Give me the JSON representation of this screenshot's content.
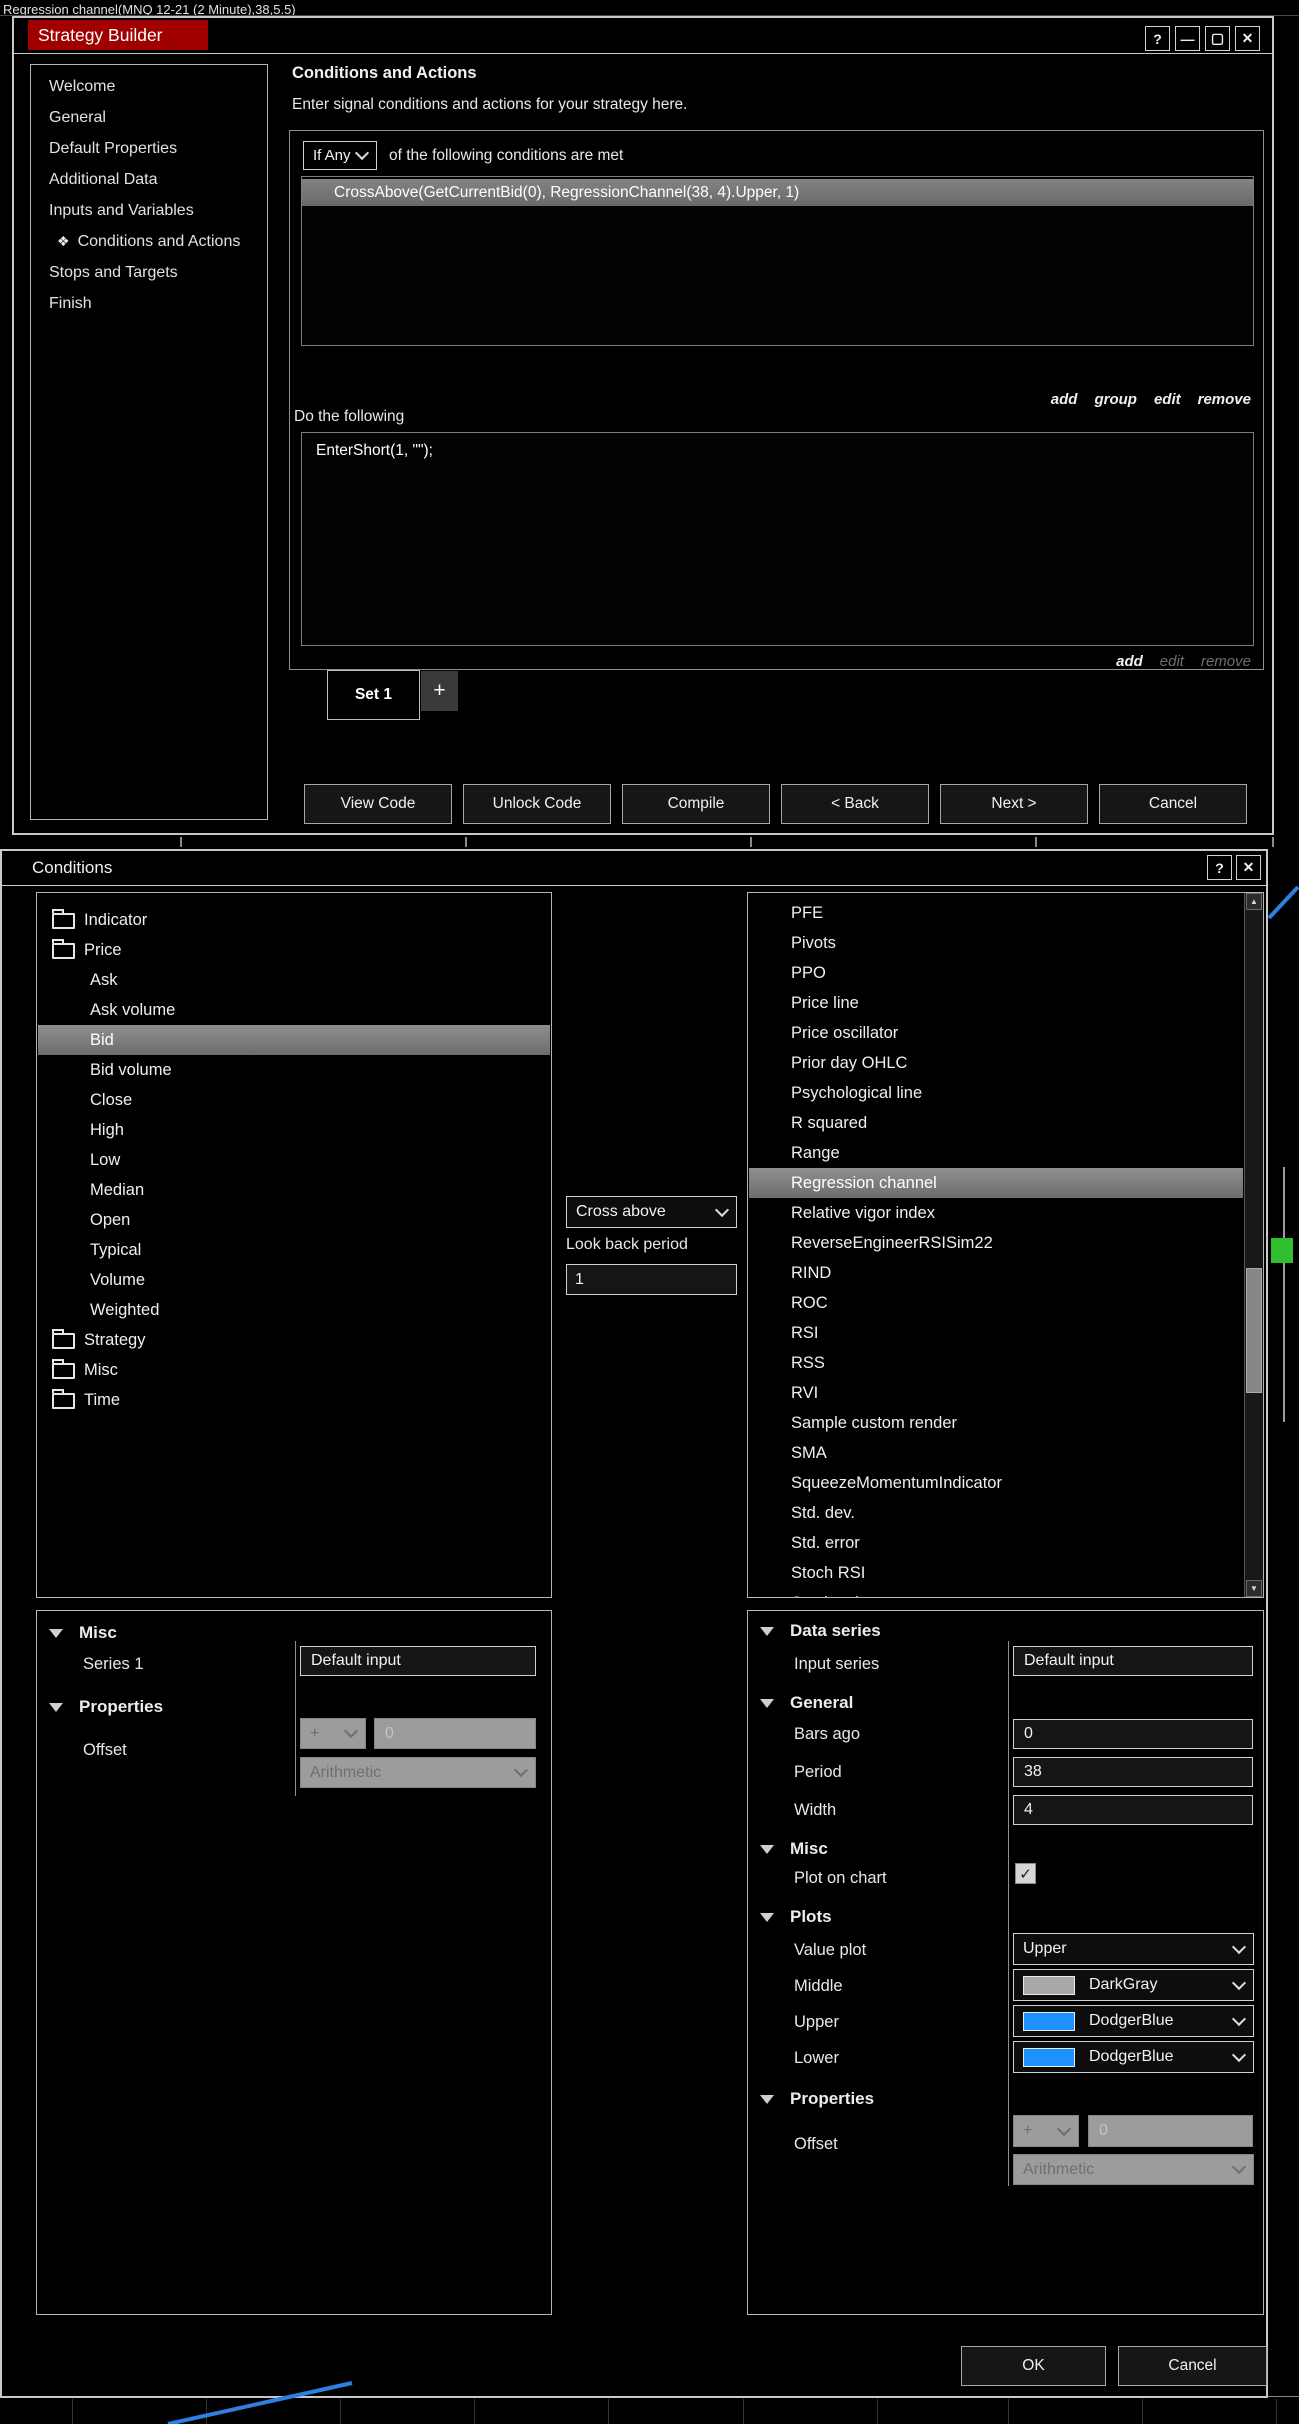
{
  "background": {
    "chart_label": "Regression channel(MNQ 12-21 (2 Minute),38,5.5)"
  },
  "colors": {
    "titlebar_red": "#A00000",
    "selection_gray": "#7a7a7a",
    "dodger_blue": "#1E90FF",
    "dark_gray_swatch": "#A9A9A9",
    "green_marker": "#2FBF2F",
    "channel_line_blue": "#2F7FE0"
  },
  "strategy_builder": {
    "title": "Strategy Builder",
    "window_controls": [
      {
        "name": "help",
        "glyph": "?"
      },
      {
        "name": "minimize",
        "glyph": "—"
      },
      {
        "name": "maximize",
        "glyph": "▢"
      },
      {
        "name": "close",
        "glyph": "✕"
      }
    ],
    "sidebar": [
      {
        "label": "Welcome"
      },
      {
        "label": "General"
      },
      {
        "label": "Default Properties"
      },
      {
        "label": "Additional Data"
      },
      {
        "label": "Inputs and Variables"
      },
      {
        "label": "Conditions and Actions",
        "selected": true,
        "icon": "❖"
      },
      {
        "label": "Stops and Targets"
      },
      {
        "label": "Finish"
      }
    ],
    "heading": "Conditions and Actions",
    "subheading": "Enter signal conditions and actions for your strategy here.",
    "condition_mode": "If Any",
    "mode_suffix": "of the following conditions are met",
    "conditions": [
      "CrossAbove(GetCurrentBid(0), RegressionChannel(38, 4).Upper, 1)"
    ],
    "conditions_links": [
      {
        "label": "add",
        "enabled": true
      },
      {
        "label": "group",
        "enabled": true
      },
      {
        "label": "edit",
        "enabled": true
      },
      {
        "label": "remove",
        "enabled": true
      }
    ],
    "do_following_label": "Do the following",
    "actions": [
      "EnterShort(1, \"\");"
    ],
    "actions_links": [
      {
        "label": "add",
        "enabled": true
      },
      {
        "label": "edit",
        "enabled": false
      },
      {
        "label": "remove",
        "enabled": false
      }
    ],
    "set_tab_label": "Set 1",
    "add_tab_label": "+",
    "footer_buttons": [
      "View Code",
      "Unlock Code",
      "Compile",
      "< Back",
      "Next >",
      "Cancel"
    ]
  },
  "conditions_dialog": {
    "title": "Conditions",
    "window_controls": [
      {
        "name": "help",
        "glyph": "?"
      },
      {
        "name": "close",
        "glyph": "✕"
      }
    ],
    "tree": [
      {
        "label": "Indicator",
        "type": "folder"
      },
      {
        "label": "Price",
        "type": "folder",
        "open": true
      },
      {
        "label": "Ask",
        "type": "item"
      },
      {
        "label": "Ask volume",
        "type": "item"
      },
      {
        "label": "Bid",
        "type": "item",
        "selected": true
      },
      {
        "label": "Bid volume",
        "type": "item"
      },
      {
        "label": "Close",
        "type": "item"
      },
      {
        "label": "High",
        "type": "item"
      },
      {
        "label": "Low",
        "type": "item"
      },
      {
        "label": "Median",
        "type": "item"
      },
      {
        "label": "Open",
        "type": "item"
      },
      {
        "label": "Typical",
        "type": "item"
      },
      {
        "label": "Volume",
        "type": "item"
      },
      {
        "label": "Weighted",
        "type": "item"
      },
      {
        "label": "Strategy",
        "type": "folder"
      },
      {
        "label": "Misc",
        "type": "folder"
      },
      {
        "label": "Time",
        "type": "folder"
      }
    ],
    "operator_select": "Cross above",
    "look_back_label": "Look back period",
    "look_back_value": "1",
    "indicators": [
      "PFE",
      "Pivots",
      "PPO",
      "Price line",
      "Price oscillator",
      "Prior day OHLC",
      "Psychological line",
      "R squared",
      "Range",
      "Regression channel",
      "Relative vigor index",
      "ReverseEngineerRSISim22",
      "RIND",
      "ROC",
      "RSI",
      "RSS",
      "RVI",
      "Sample custom render",
      "SMA",
      "SqueezeMomentumIndicator",
      "Std. dev.",
      "Std. error",
      "Stoch RSI",
      "Stochastic"
    ],
    "selected_indicator": "Regression channel",
    "left_props": {
      "misc_header": "Misc",
      "series_label": "Series 1",
      "series_value": "Default input",
      "properties_header": "Properties",
      "offset_label": "Offset",
      "offset_op": "+",
      "offset_value": "0",
      "offset_mode": "Arithmetic"
    },
    "right_props": {
      "data_series_header": "Data series",
      "input_series_label": "Input series",
      "input_series_value": "Default input",
      "general_header": "General",
      "bars_ago_label": "Bars ago",
      "bars_ago_value": "0",
      "period_label": "Period",
      "period_value": "38",
      "width_label": "Width",
      "width_value": "4",
      "misc_header": "Misc",
      "plot_on_chart_label": "Plot on chart",
      "plot_on_chart_checked": "✓",
      "plots_header": "Plots",
      "value_plot_label": "Value plot",
      "value_plot_value": "Upper",
      "middle_label": "Middle",
      "middle_value": "DarkGray",
      "middle_color": "#A9A9A9",
      "upper_label": "Upper",
      "upper_value": "DodgerBlue",
      "upper_color": "#1E90FF",
      "lower_label": "Lower",
      "lower_value": "DodgerBlue",
      "lower_color": "#1E90FF",
      "properties_header": "Properties",
      "offset_label": "Offset",
      "offset_op": "+",
      "offset_value": "0",
      "offset_mode": "Arithmetic"
    },
    "ok_label": "OK",
    "cancel_label": "Cancel"
  }
}
